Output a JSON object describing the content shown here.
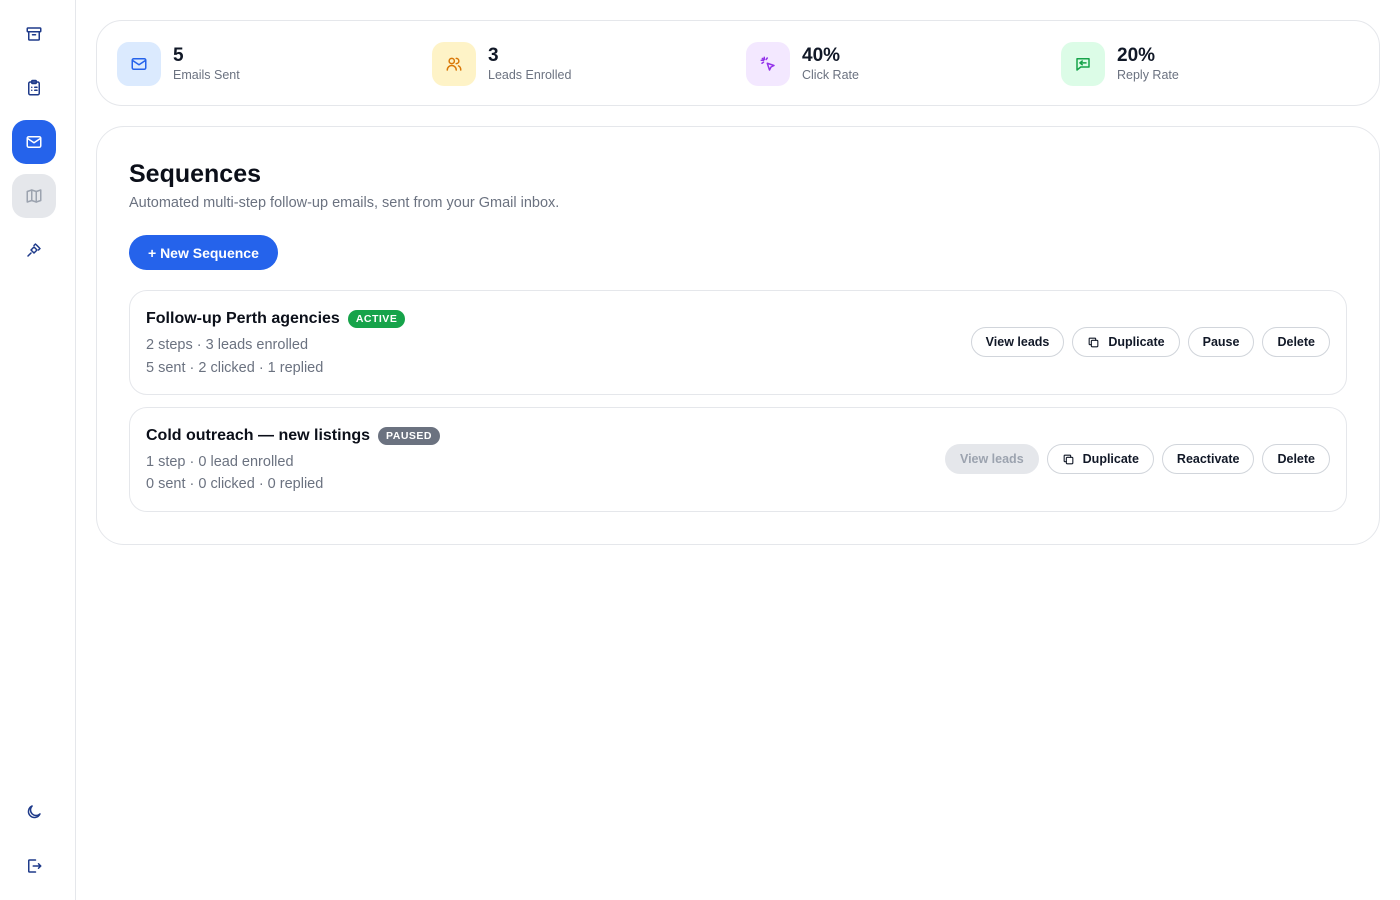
{
  "sidebar": {
    "items": [
      {
        "icon": "archive-icon"
      },
      {
        "icon": "clipboard-icon"
      },
      {
        "icon": "mail-icon",
        "active": true
      },
      {
        "icon": "map-icon",
        "hover": true
      },
      {
        "icon": "plug-icon"
      }
    ],
    "bottom": [
      {
        "icon": "moon-icon"
      },
      {
        "icon": "logout-icon"
      }
    ]
  },
  "stats": [
    {
      "value": "5",
      "label": "Emails Sent",
      "icon": "mail-icon",
      "bg": "#dbeafe",
      "fg": "#2563eb"
    },
    {
      "value": "3",
      "label": "Leads Enrolled",
      "icon": "users-icon",
      "bg": "#fef3c7",
      "fg": "#d97706"
    },
    {
      "value": "40%",
      "label": "Click Rate",
      "icon": "pointer-click-icon",
      "bg": "#f3e8ff",
      "fg": "#9333ea"
    },
    {
      "value": "20%",
      "label": "Reply Rate",
      "icon": "reply-message-icon",
      "bg": "#dcfce7",
      "fg": "#16a34a"
    }
  ],
  "sequences_panel": {
    "title": "Sequences",
    "subtitle": "Automated multi-step follow-up emails, sent from your Gmail inbox.",
    "new_button": "+ New Sequence"
  },
  "sequences": [
    {
      "name": "Follow-up Perth agencies",
      "status": "ACTIVE",
      "line1": "2 steps · 3 leads enrolled",
      "line2": "5 sent · 2 clicked · 1 replied",
      "actions": {
        "view": "View leads",
        "duplicate": "Duplicate",
        "toggle": "Pause",
        "delete": "Delete"
      },
      "view_disabled": false
    },
    {
      "name": "Cold outreach — new listings",
      "status": "PAUSED",
      "line1": "1 step · 0 lead enrolled",
      "line2": "0 sent · 0 clicked · 0 replied",
      "actions": {
        "view": "View leads",
        "duplicate": "Duplicate",
        "toggle": "Reactivate",
        "delete": "Delete"
      },
      "view_disabled": true
    }
  ],
  "colors": {
    "accent": "#2563eb",
    "active_badge": "#16a34a",
    "paused_badge": "#6b7280"
  }
}
